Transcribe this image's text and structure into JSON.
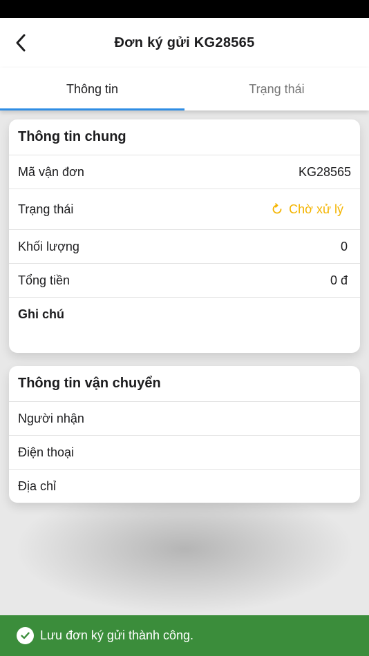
{
  "header": {
    "title": "Đơn ký gửi KG28565"
  },
  "tabs": [
    {
      "label": "Thông tin",
      "active": true
    },
    {
      "label": "Trạng thái",
      "active": false
    }
  ],
  "general": {
    "title": "Thông tin chung",
    "waybill_label": "Mã vận đơn",
    "waybill_value": "KG28565",
    "status_label": "Trạng thái",
    "status_value": "Chờ xử lý",
    "weight_label": "Khối lượng",
    "weight_value": "0",
    "total_label": "Tổng tiền",
    "total_value": "0 đ",
    "note_label": "Ghi chú"
  },
  "shipping": {
    "title": "Thông tin vận chuyển",
    "receiver_label": "Người nhận",
    "phone_label": "Điện thoại",
    "address_label": "Địa chỉ"
  },
  "toast": {
    "message": "Lưu đơn ký gửi thành công."
  },
  "colors": {
    "accent": "#2f8de4",
    "status_pending": "#f4b400",
    "total_red": "#e53935",
    "toast_green": "#3b8d3b"
  },
  "icons": {
    "back": "chevron-left-icon",
    "status": "refresh-icon",
    "toast": "check-circle-icon"
  }
}
